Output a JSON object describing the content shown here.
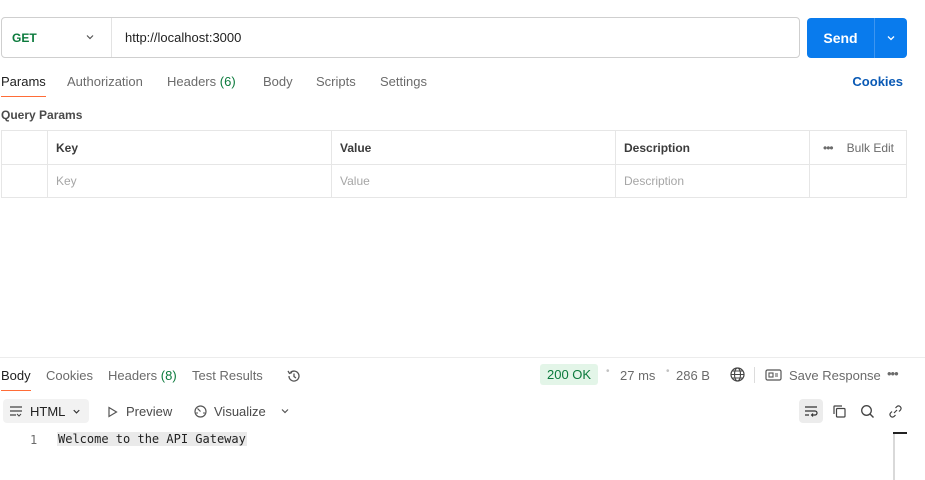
{
  "request": {
    "method": "GET",
    "url": "http://localhost:3000",
    "send_label": "Send"
  },
  "request_tabs": {
    "params": "Params",
    "authorization": "Authorization",
    "headers_label": "Headers",
    "headers_count": "(6)",
    "body": "Body",
    "scripts": "Scripts",
    "settings": "Settings",
    "cookies": "Cookies"
  },
  "query_params": {
    "title": "Query Params",
    "columns": {
      "key": "Key",
      "value": "Value",
      "description": "Description",
      "bulk_edit": "Bulk Edit"
    },
    "placeholders": {
      "key": "Key",
      "value": "Value",
      "description": "Description"
    }
  },
  "response_tabs": {
    "body": "Body",
    "cookies": "Cookies",
    "headers_label": "Headers",
    "headers_count": "(8)",
    "test_results": "Test Results"
  },
  "response_meta": {
    "status": "200 OK",
    "time": "27 ms",
    "size": "286 B",
    "save_response": "Save Response"
  },
  "response_toolbar": {
    "format": "HTML",
    "preview": "Preview",
    "visualize": "Visualize"
  },
  "response_body": {
    "line_number": "1",
    "line_text": "Welcome to the API Gateway"
  },
  "colors": {
    "accent": "#097bed",
    "method_green": "#0b7a3c",
    "tab_indicator": "#ff6c37",
    "status_bg": "#e3f5e8"
  },
  "icons": [
    "chevron-down-icon",
    "history-icon",
    "globe-icon",
    "save-icon",
    "more-icon",
    "wrap-icon",
    "copy-icon",
    "search-icon",
    "link-icon",
    "play-icon",
    "visualize-icon",
    "format-icon"
  ]
}
